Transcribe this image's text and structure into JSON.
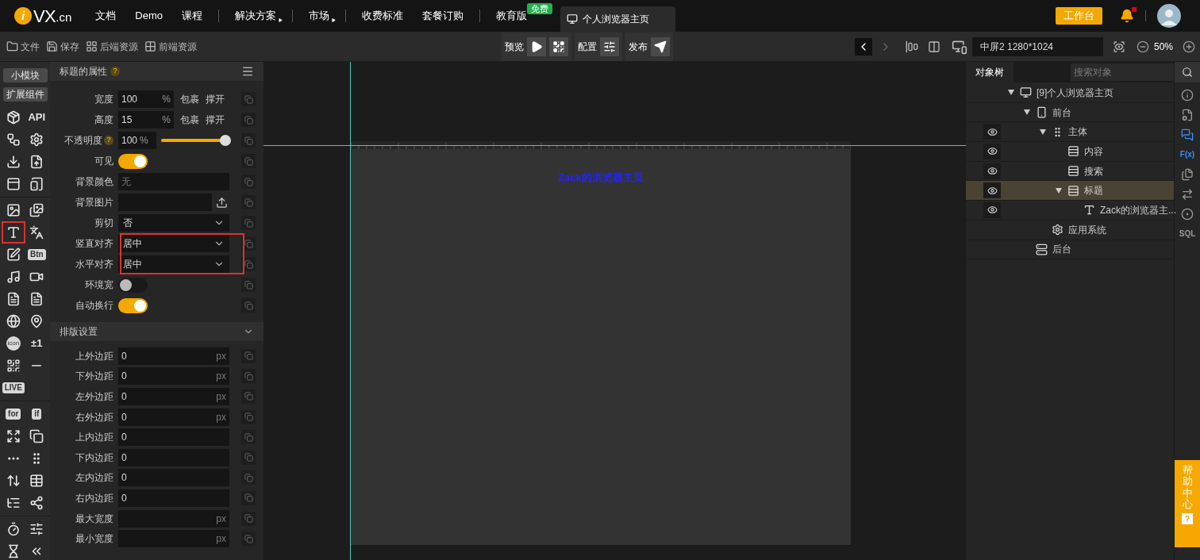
{
  "nav": {
    "logo": {
      "badge": "i",
      "name": "VX",
      "suffix": ".cn"
    },
    "items": [
      {
        "label": "文档",
        "dropdown": false,
        "separator_before": false
      },
      {
        "label": "Demo",
        "dropdown": false,
        "separator_before": false
      },
      {
        "label": "课程",
        "dropdown": false,
        "separator_before": false
      },
      {
        "label": "解决方案",
        "dropdown": true,
        "separator_before": true
      },
      {
        "label": "市场",
        "dropdown": true,
        "separator_before": true
      },
      {
        "label": "收费标准",
        "dropdown": false,
        "separator_before": true
      },
      {
        "label": "套餐订购",
        "dropdown": false,
        "separator_before": false
      },
      {
        "label": "教育版",
        "dropdown": false,
        "separator_before": true,
        "badge": "免费"
      }
    ],
    "tab": {
      "label": "个人浏览器主页",
      "selected": true
    },
    "workbench_button": "工作台",
    "notifications": {
      "unread": true
    }
  },
  "toolbar": {
    "left": [
      {
        "kind": "folder",
        "label": "文件"
      },
      {
        "kind": "save",
        "label": "保存"
      },
      {
        "kind": "grid",
        "label": "后端资源"
      },
      {
        "kind": "tiles",
        "label": "前端资源"
      }
    ],
    "center": [
      {
        "label": "预览"
      },
      {
        "label": "配置"
      },
      {
        "label": "发布"
      }
    ],
    "back_enabled": true,
    "forward_enabled": false,
    "screen": "中屏2 1280*1024",
    "zoom": "50%"
  },
  "palette": {
    "buttons": [
      "小模块",
      "扩展组件"
    ],
    "groups": [
      [
        {
          "kind": "icon",
          "highlighted": false
        },
        {
          "kind": "text",
          "label": "API",
          "highlighted": false
        },
        {
          "kind": "icon",
          "highlighted": false
        },
        {
          "kind": "icon",
          "highlighted": false
        },
        {
          "kind": "icon",
          "highlighted": false
        },
        {
          "kind": "icon",
          "highlighted": false
        },
        {
          "kind": "icon",
          "highlighted": false
        },
        {
          "kind": "icon",
          "highlighted": false
        }
      ],
      [
        {
          "kind": "icon",
          "highlighted": false
        },
        {
          "kind": "icon",
          "highlighted": false
        },
        {
          "kind": "icon",
          "highlighted": true
        },
        {
          "kind": "icon",
          "highlighted": false
        },
        {
          "kind": "icon",
          "highlighted": false
        },
        {
          "kind": "tag",
          "label": "Btn",
          "highlighted": false
        },
        {
          "kind": "icon",
          "highlighted": false
        },
        {
          "kind": "icon",
          "highlighted": false
        },
        {
          "kind": "icon",
          "highlighted": false
        },
        {
          "kind": "icon",
          "highlighted": false
        },
        {
          "kind": "icon",
          "highlighted": false
        },
        {
          "kind": "icon",
          "highlighted": false
        },
        {
          "kind": "round",
          "label": "icon",
          "highlighted": false
        },
        {
          "kind": "text",
          "label": "±1",
          "highlighted": false
        },
        {
          "kind": "icon",
          "highlighted": false
        },
        {
          "kind": "icon",
          "highlighted": false
        },
        {
          "kind": "tag",
          "label": "LIVE",
          "highlighted": false
        }
      ],
      [
        {
          "kind": "tag",
          "label": "for",
          "highlighted": false
        },
        {
          "kind": "tag",
          "label": "if",
          "highlighted": false
        },
        {
          "kind": "icon",
          "highlighted": false
        },
        {
          "kind": "icon",
          "highlighted": false
        },
        {
          "kind": "icon",
          "highlighted": false
        },
        {
          "kind": "icon",
          "highlighted": false
        },
        {
          "kind": "icon",
          "highlighted": false
        },
        {
          "kind": "icon",
          "highlighted": false
        },
        {
          "kind": "icon",
          "highlighted": false
        },
        {
          "kind": "icon",
          "highlighted": false
        }
      ],
      [
        {
          "kind": "icon",
          "highlighted": false
        },
        {
          "kind": "icon",
          "highlighted": false
        },
        {
          "kind": "icon",
          "highlighted": false
        },
        {
          "kind": "icon",
          "highlighted": false
        }
      ]
    ]
  },
  "properties": {
    "title": "标题的属性",
    "help": "?",
    "rows": [
      {
        "kind": "size",
        "label": "宽度",
        "value": "100",
        "unit": "%",
        "options": [
          "包裹",
          "撑开"
        ],
        "highlighted": false
      },
      {
        "kind": "size",
        "label": "高度",
        "value": "15",
        "unit": "%",
        "options": [
          "包裹",
          "撑开"
        ],
        "highlighted": false
      },
      {
        "kind": "slider",
        "label": "不透明度",
        "help": "?",
        "value": "100",
        "unit": "%",
        "level": 1,
        "highlighted": false
      },
      {
        "kind": "toggle",
        "label": "可见",
        "on": true,
        "highlighted": false
      },
      {
        "kind": "field",
        "label": "背景颜色",
        "placeholder": "无",
        "highlighted": false
      },
      {
        "kind": "upload",
        "label": "背景图片",
        "highlighted": false
      },
      {
        "kind": "select",
        "label": "剪切",
        "value": "否",
        "highlighted": false
      },
      {
        "kind": "select",
        "label": "竖直对齐",
        "value": "居中",
        "highlighted": true
      },
      {
        "kind": "select",
        "label": "水平对齐",
        "value": "居中",
        "highlighted": true
      },
      {
        "kind": "toggle",
        "label": "环境宽",
        "on": false,
        "highlighted": false
      },
      {
        "kind": "toggle",
        "label": "自动换行",
        "on": true,
        "highlighted": false
      }
    ],
    "section": {
      "title": "排版设置",
      "expanded": true,
      "rows": [
        {
          "label": "上外边距",
          "value": "0",
          "unit": "px"
        },
        {
          "label": "下外边距",
          "value": "0",
          "unit": "px"
        },
        {
          "label": "左外边距",
          "value": "0",
          "unit": "px"
        },
        {
          "label": "右外边距",
          "value": "0",
          "unit": "px"
        },
        {
          "label": "上内边距",
          "value": "0"
        },
        {
          "label": "下内边距",
          "value": "0"
        },
        {
          "label": "左内边距",
          "value": "0"
        },
        {
          "label": "右内边距",
          "value": "0"
        },
        {
          "label": "最大宽度",
          "unit": "px"
        },
        {
          "label": "最小宽度",
          "unit": "px"
        }
      ]
    }
  },
  "canvas": {
    "title": "Zack的浏览器主页"
  },
  "object_tree": {
    "tab": "对象树",
    "search_placeholder": "搜索对象",
    "nodes": [
      {
        "kind": "page",
        "label": "[9]个人浏览器主页",
        "eye": false,
        "selected": false,
        "expanded": true,
        "children": [
          {
            "kind": "phone",
            "label": "前台",
            "eye": false,
            "selected": false,
            "expanded": true,
            "children": [
              {
                "kind": "column",
                "label": "主体",
                "eye": true,
                "selected": false,
                "expanded": true,
                "children": [
                  {
                    "kind": "row",
                    "label": "内容",
                    "eye": true,
                    "selected": false
                  },
                  {
                    "kind": "row",
                    "label": "搜索",
                    "eye": true,
                    "selected": false
                  },
                  {
                    "kind": "row",
                    "label": "标题",
                    "eye": true,
                    "selected": true,
                    "expanded": true,
                    "children": [
                      {
                        "kind": "text",
                        "label": "Zack的浏览器主...",
                        "eye": true,
                        "selected": false
                      }
                    ]
                  }
                ]
              },
              {
                "kind": "gear",
                "label": "应用系统",
                "eye": false,
                "selected": false
              }
            ]
          },
          {
            "kind": "server",
            "label": "后台",
            "eye": false,
            "selected": false
          }
        ]
      }
    ]
  },
  "right_rail": [
    {
      "kind": "icon",
      "active": false
    },
    {
      "kind": "icon",
      "active": false
    },
    {
      "kind": "icon",
      "active": true
    },
    {
      "kind": "text",
      "label": "F(x)",
      "active": true
    },
    {
      "kind": "icon",
      "active": false
    },
    {
      "kind": "icon",
      "active": false
    },
    {
      "kind": "icon",
      "active": false
    },
    {
      "kind": "text",
      "label": "SQL",
      "active": false
    }
  ],
  "help_tab": {
    "label": "帮助中心",
    "mark": "?"
  }
}
